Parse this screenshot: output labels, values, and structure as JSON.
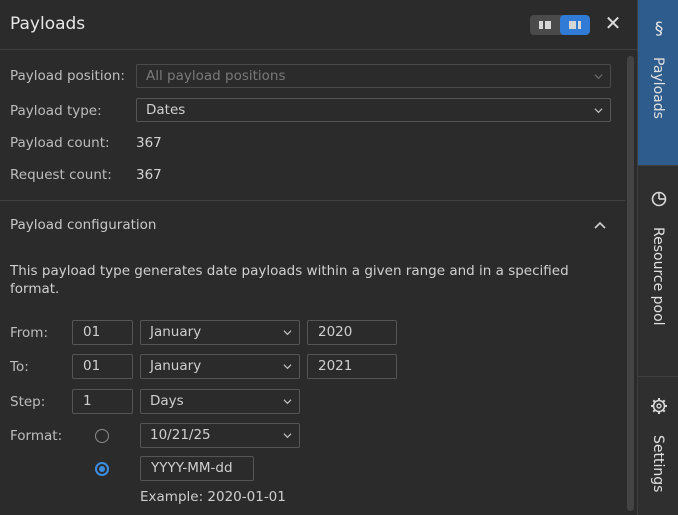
{
  "header": {
    "title": "Payloads"
  },
  "fields": {
    "position_label": "Payload position:",
    "position_value": "All payload positions",
    "type_label": "Payload type:",
    "type_value": "Dates",
    "payload_count_label": "Payload count:",
    "payload_count_value": "367",
    "request_count_label": "Request count:",
    "request_count_value": "367"
  },
  "config": {
    "title": "Payload configuration",
    "description": "This payload type generates date payloads within a given range and in a specified format.",
    "from": {
      "label": "From:",
      "day": "01",
      "month": "January",
      "year": "2020"
    },
    "to": {
      "label": "To:",
      "day": "01",
      "month": "January",
      "year": "2021"
    },
    "step": {
      "label": "Step:",
      "value": "1",
      "unit": "Days"
    },
    "format": {
      "label": "Format:",
      "preset": "10/21/25",
      "custom": "YYYY-MM-dd",
      "selected": "custom"
    },
    "example": "Example: 2020-01-01"
  },
  "sidebar": {
    "tabs": [
      {
        "label": "Payloads",
        "icon": "payload-icon",
        "active": true
      },
      {
        "label": "Resource pool",
        "icon": "pie-chart-icon",
        "active": false
      },
      {
        "label": "Settings",
        "icon": "gear-icon",
        "active": false
      }
    ]
  },
  "colors": {
    "accent": "#2f7bd6",
    "active_tab": "#2e5c8c",
    "radio_selected": "#3b8de0"
  }
}
